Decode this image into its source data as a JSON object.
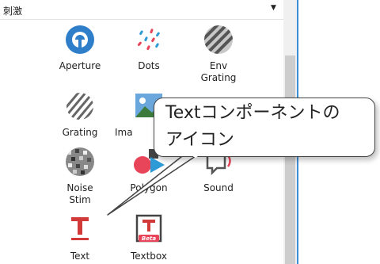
{
  "panel": {
    "title": "刺激"
  },
  "items": [
    {
      "label": "Aperture",
      "icon": "aperture-icon"
    },
    {
      "label": "Dots",
      "icon": "dots-icon"
    },
    {
      "label": "Env\nGrating",
      "icon": "env-grating-icon"
    },
    {
      "label": "Grating",
      "icon": "grating-icon"
    },
    {
      "label": "Ima",
      "icon": "image-icon"
    },
    {
      "label": "Noise\nStim",
      "icon": "noise-stim-icon"
    },
    {
      "label": "Polygon",
      "icon": "polygon-icon"
    },
    {
      "label": "Sound",
      "icon": "sound-icon"
    },
    {
      "label": "Text",
      "icon": "text-icon"
    },
    {
      "label": "Textbox",
      "icon": "textbox-icon"
    }
  ],
  "textbox_badge": "Beta",
  "callout": {
    "text": "Textコンポーネントの\nアイコン"
  },
  "colors": {
    "accent": "#2e7ec9",
    "text_red": "#d23a3a",
    "window_edge": "#3b8fd8"
  }
}
